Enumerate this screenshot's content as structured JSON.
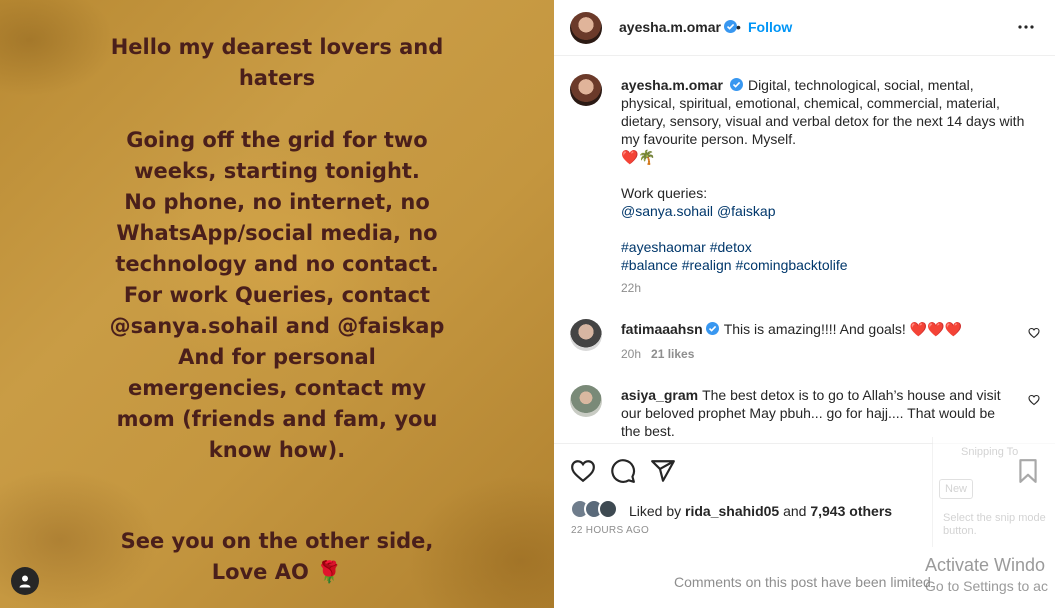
{
  "media": {
    "text_block_1": [
      "Hello my dearest lovers and",
      "haters"
    ],
    "text_block_2": [
      "Going off the grid for two",
      "weeks, starting tonight.",
      "No phone, no internet, no",
      "WhatsApp/social media, no",
      "technology and no contact.",
      "For work Queries, contact",
      "@sanya.sohail and @faiskap",
      "And for personal",
      "emergencies, contact my",
      "mom (friends and fam, you",
      "know how)."
    ],
    "text_block_3": [
      "See you on the other side,",
      "Love AO 🌹"
    ]
  },
  "header": {
    "username": "ayesha.m.omar",
    "dot": "•",
    "follow_label": "Follow"
  },
  "caption": {
    "username": "ayesha.m.omar",
    "text": "Digital, technological, social, mental, physical, spiritual, emotional, chemical, commercial, material, dietary, sensory, visual and verbal detox for the next 14 days with my favourite person. Myself.",
    "emoji": "❤️🌴",
    "work_label": "Work queries:",
    "mention_1": "@sanya.sohail",
    "mention_2": "@faiskap",
    "tags_line_1": [
      "#ayeshaomar",
      "#detox"
    ],
    "tags_line_2": [
      "#balance",
      "#realign",
      "#comingbacktolife"
    ],
    "time": "22h"
  },
  "comments": [
    {
      "username": "fatimaaahsn",
      "verified": true,
      "text": "This is amazing!!!! And goals! ❤️❤️❤️",
      "time": "20h",
      "likes": "21 likes"
    },
    {
      "username": "asiya_gram",
      "verified": false,
      "text": "The best detox is to go to Allah’s house and visit our beloved prophet May pbuh... go for hajj.... That would be the best."
    }
  ],
  "actions": {
    "liked_prefix": "Liked by",
    "liked_user": "rida_shahid05",
    "liked_and": "and",
    "liked_others": "7,943 others",
    "post_date": "22 HOURS AGO",
    "comments_limited": "Comments on this post have been limited"
  },
  "overlay": {
    "snip_title": "Snipping To",
    "snip_button": "New",
    "snip_message": "Select the snip mode button.",
    "activate_line_1": "Activate Windo",
    "activate_line_2": "Go to Settings to ac"
  },
  "colors": {
    "link": "#00376b",
    "follow": "#0095f6",
    "verified": "#3897f0",
    "media_text": "#4a1f1b",
    "heart_red": "#ed4956"
  }
}
